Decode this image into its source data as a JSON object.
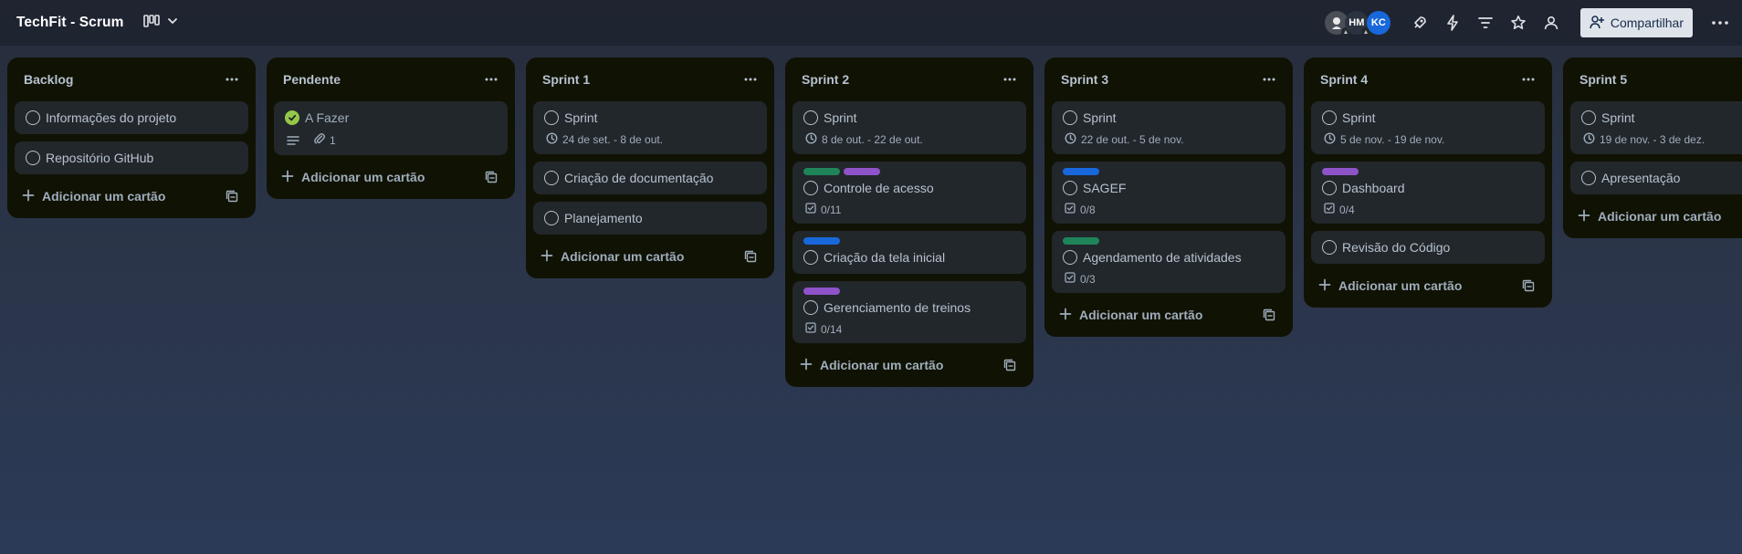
{
  "board": {
    "title": "TechFit - Scrum",
    "share_label": "Compartilhar",
    "members": [
      {
        "initials": ""
      },
      {
        "initials": "HM"
      },
      {
        "initials": "KC"
      }
    ],
    "icons": [
      "power-up-icon",
      "automation-icon",
      "filter-icon",
      "star-icon",
      "visibility-icon"
    ]
  },
  "colors": {
    "label_green": "#1f845a",
    "label_purple": "#8f53c9",
    "label_blue": "#1868db",
    "done_green": "#94c748"
  },
  "add_card_label": "Adicionar um cartão",
  "lists": [
    {
      "title": "Backlog",
      "cards": [
        {
          "title": "Informações do projeto"
        },
        {
          "title": "Repositório GitHub"
        }
      ]
    },
    {
      "title": "Pendente",
      "cards": [
        {
          "title": "A Fazer",
          "done": true,
          "description": true,
          "attachments": "1"
        }
      ]
    },
    {
      "title": "Sprint 1",
      "cards": [
        {
          "title": "Sprint",
          "dates": "24 de set. - 8 de out."
        },
        {
          "title": "Criação de documentação"
        },
        {
          "title": "Planejamento"
        }
      ]
    },
    {
      "title": "Sprint 2",
      "cards": [
        {
          "title": "Sprint",
          "dates": "8 de out. - 22 de out."
        },
        {
          "title": "Controle de acesso",
          "labels": [
            "green",
            "purple"
          ],
          "checklist": "0/11"
        },
        {
          "title": "Criação da tela inicial",
          "labels": [
            "blue"
          ]
        },
        {
          "title": "Gerenciamento de treinos",
          "labels": [
            "purple"
          ],
          "checklist": "0/14"
        }
      ]
    },
    {
      "title": "Sprint 3",
      "cards": [
        {
          "title": "Sprint",
          "dates": "22 de out. - 5 de nov."
        },
        {
          "title": "SAGEF",
          "labels": [
            "blue"
          ],
          "checklist": "0/8"
        },
        {
          "title": "Agendamento de atividades",
          "labels": [
            "green"
          ],
          "checklist": "0/3"
        }
      ]
    },
    {
      "title": "Sprint 4",
      "cards": [
        {
          "title": "Sprint",
          "dates": "5 de nov. - 19 de nov."
        },
        {
          "title": "Dashboard",
          "labels": [
            "purple"
          ],
          "checklist": "0/4"
        },
        {
          "title": "Revisão do Código"
        }
      ]
    },
    {
      "title": "Sprint 5",
      "cards": [
        {
          "title": "Sprint",
          "dates": "19 de nov. - 3 de dez."
        },
        {
          "title": "Apresentação"
        }
      ]
    }
  ]
}
